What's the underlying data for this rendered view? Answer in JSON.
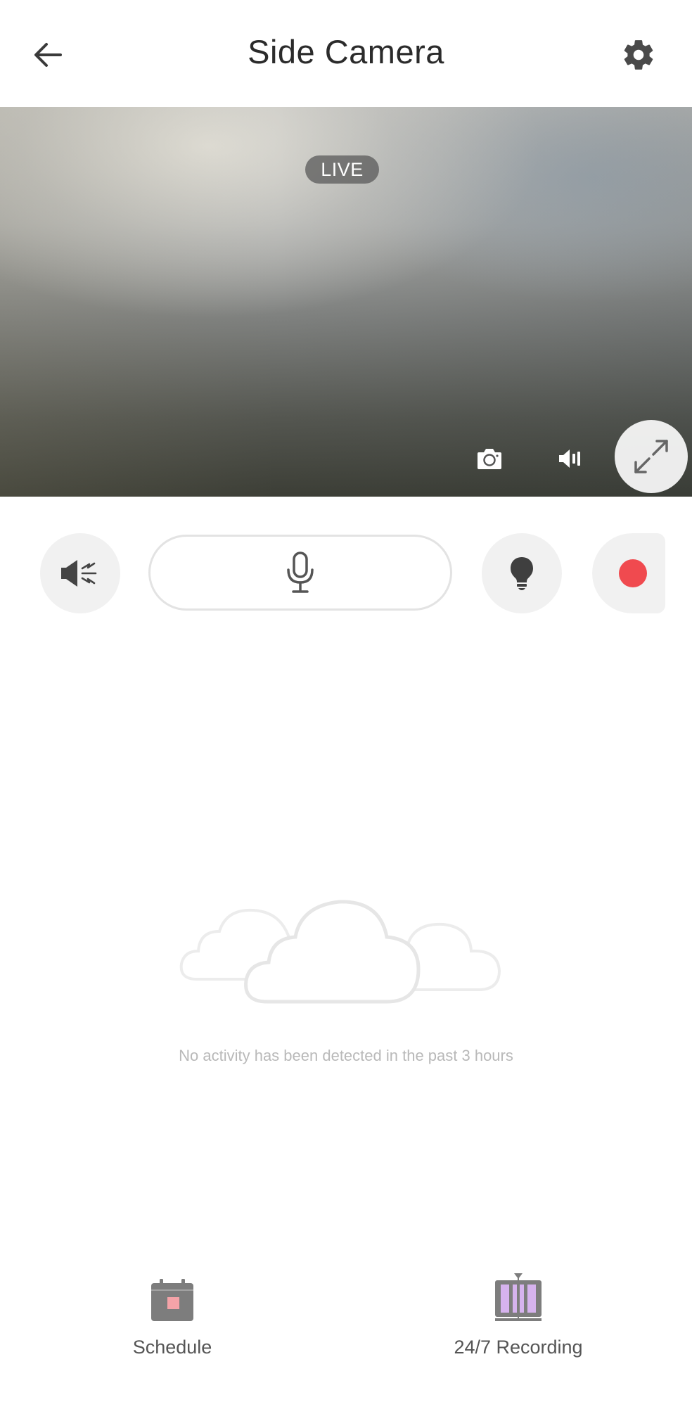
{
  "header": {
    "title": "Side Camera",
    "back_icon": "arrow-left-icon",
    "settings_icon": "gear-icon"
  },
  "video": {
    "live_label": "LIVE",
    "snapshot_icon": "camera-icon",
    "volume_icon": "speaker-icon",
    "fullscreen_icon": "expand-icon"
  },
  "controls": {
    "siren_icon": "siren-speaker-icon",
    "talk_icon": "microphone-icon",
    "light_icon": "lightbulb-icon",
    "record_icon": "record-dot-icon",
    "record_color": "#f04a4f"
  },
  "empty_state": {
    "illustration": "clouds-icon",
    "message": "No activity has been detected in the past 3 hours"
  },
  "bottom_nav": [
    {
      "label": "Schedule",
      "icon": "calendar-icon",
      "accent": "#f4a3a8"
    },
    {
      "label": "24/7 Recording",
      "icon": "film-strip-icon",
      "accent": "#d6b3ee"
    }
  ]
}
